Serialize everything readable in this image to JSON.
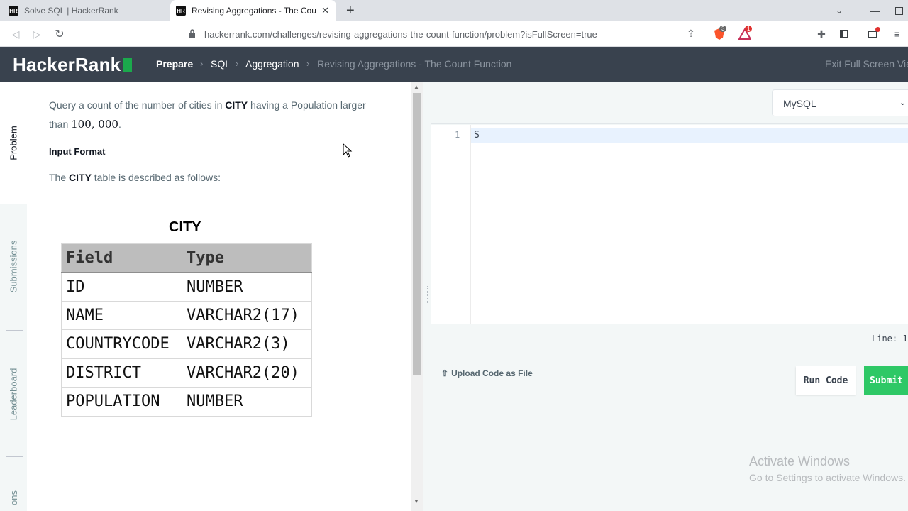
{
  "browser": {
    "tabs": [
      {
        "title": "Solve SQL | HackerRank",
        "active": false
      },
      {
        "title": "Revising Aggregations - The Cou",
        "active": true
      }
    ],
    "new_tab_icon": "plus-icon",
    "url": "hackerrank.com/challenges/revising-aggregations-the-count-function/problem?isFullScreen=true",
    "brave_badge": "3",
    "alert_badge": "1"
  },
  "header": {
    "logo": "HackerRank",
    "breadcrumbs": [
      "Prepare",
      "SQL",
      "Aggregation",
      "Revising Aggregations - The Count Function"
    ],
    "exit_fullscreen": "Exit Full Screen Vie"
  },
  "side_tabs": [
    "Problem",
    "Submissions",
    "Leaderboard",
    "ons"
  ],
  "problem": {
    "line1_pre": "Query a count of the number of cities in ",
    "line1_bold": "CITY",
    "line1_post": " having a Population larger",
    "line2_pre": "than ",
    "line2_num": "100, 000",
    "line2_post": ".",
    "input_format_heading": "Input Format",
    "desc_pre": "The ",
    "desc_bold": "CITY",
    "desc_post": " table is described as follows:",
    "table_title": "CITY",
    "table_headers": [
      "Field",
      "Type"
    ],
    "table_rows": [
      [
        "ID",
        "NUMBER"
      ],
      [
        "NAME",
        "VARCHAR2(17)"
      ],
      [
        "COUNTRYCODE",
        "VARCHAR2(3)"
      ],
      [
        "DISTRICT",
        "VARCHAR2(20)"
      ],
      [
        "POPULATION",
        "NUMBER"
      ]
    ]
  },
  "editor": {
    "language": "MySQL",
    "line_number": "1",
    "code": "S",
    "line_info": "Line: 1",
    "upload_label": "Upload Code as File",
    "run_label": "Run Code",
    "submit_label": "Submit"
  },
  "watermark": {
    "line1": "Activate Windows",
    "line2": "Go to Settings to activate Windows."
  }
}
